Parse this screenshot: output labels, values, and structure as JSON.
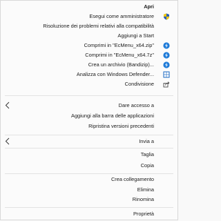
{
  "menu": {
    "open": "Apri",
    "run_as_admin": "Esegui come amministratore",
    "troubleshoot_compat": "Risoluzione dei problemi relativi alla compatibilità",
    "pin_to_start": "Aggiungi a Start",
    "compress_zip": "Comprimi in \"EcMenu_x64.zip\"",
    "compress_7z": "Comprimi in \"EcMenu_x64.7z\"",
    "create_archive": "Crea un archivio (Bandizip)...",
    "scan_defender": "Analizza con Windows Defender...",
    "share": "Condivisione",
    "give_access": "Dare accesso a",
    "pin_taskbar": "Aggiungi alla barra delle applicazioni",
    "restore_versions": "Ripristina versioni precedenti",
    "send_to": "Invia a",
    "cut": "Taglia",
    "copy": "Copia",
    "create_shortcut": "Crea collegamento",
    "delete": "Elimina",
    "rename": "Rinomina",
    "properties": "Proprietà"
  },
  "icons": {
    "admin_shield": "uac-shield-icon",
    "bandizip": "bandizip-icon",
    "defender": "windows-defender-icon",
    "share": "share-icon",
    "submenu": "chevron-left-icon"
  },
  "colors": {
    "menu_bg": "#fbfbfb",
    "text": "#1a1a1a",
    "separator": "#e2e2e2",
    "bandizip_blue": "#1f7bd8",
    "defender_blue": "#1565c0"
  }
}
